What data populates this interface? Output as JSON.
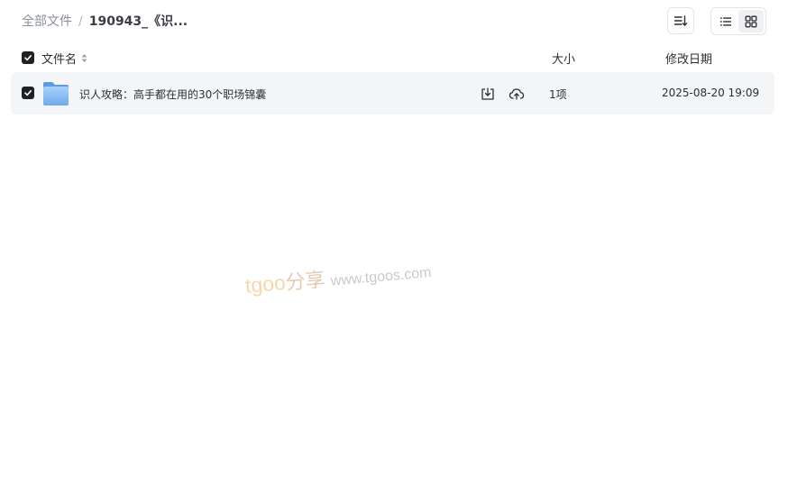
{
  "breadcrumb": {
    "root": "全部文件",
    "separator": "/",
    "current": "190943_《识..."
  },
  "toolbar": {
    "sort_icon": "sort-descending-icon",
    "list_view_icon": "list-view-icon",
    "grid_view_icon": "grid-view-icon"
  },
  "table": {
    "columns": {
      "name": "文件名",
      "size": "大小",
      "date": "修改日期"
    },
    "rows": [
      {
        "icon": "folder-icon",
        "name": "识人攻略：高手都在用的30个职场锦囊",
        "size": "1项",
        "date": "2025-08-20 19:09",
        "checked": true
      }
    ]
  },
  "watermark": {
    "brand": "tgoo",
    "brand_cn": "分享",
    "url": "www.tgoos.com"
  },
  "colors": {
    "row_bg": "#f4f5f6",
    "checkbox": "#1f2126",
    "folder": "#7fb5f0",
    "watermark": "#f0b869"
  }
}
